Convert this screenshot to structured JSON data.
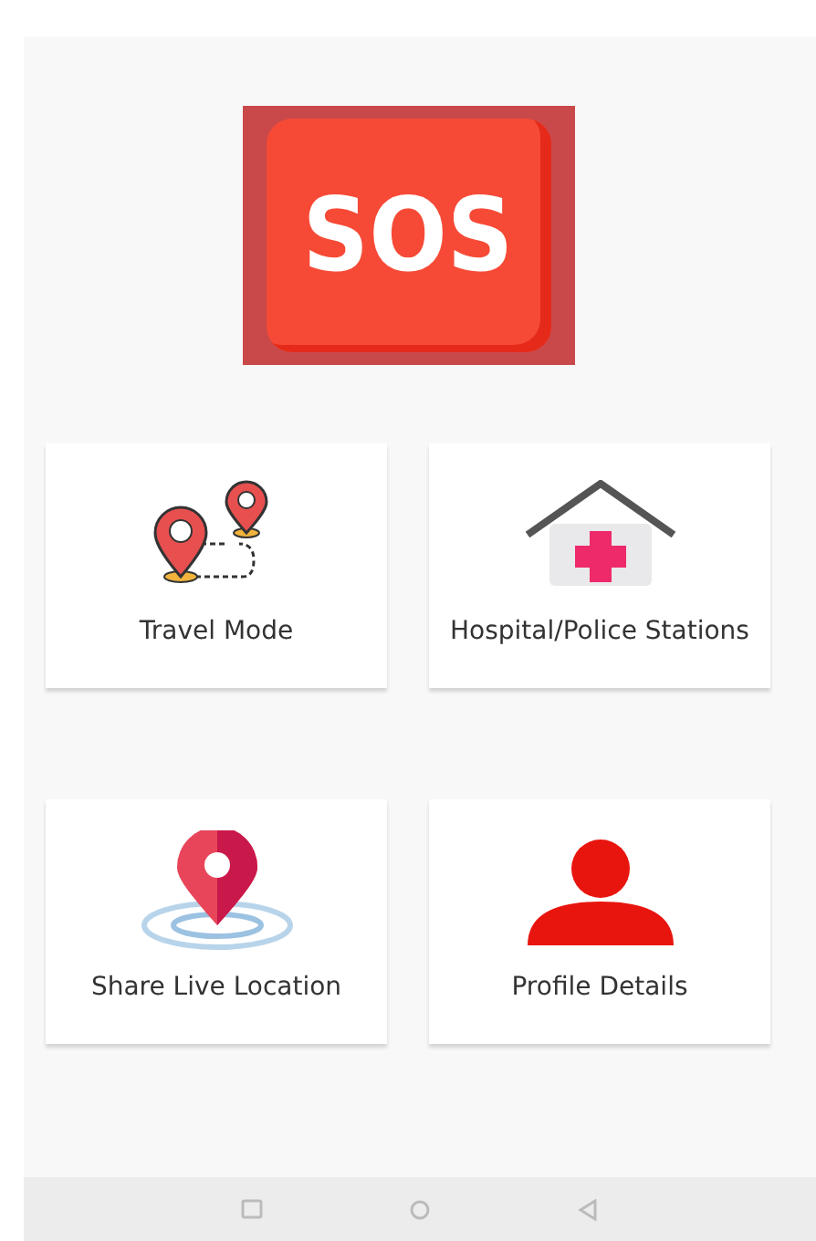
{
  "sos_button": {
    "label": "SOS"
  },
  "cards": [
    {
      "kind": "travel",
      "label": "Travel Mode"
    },
    {
      "kind": "hospital",
      "label": "Hospital/Police Stations"
    },
    {
      "kind": "location",
      "label": "Share Live Location"
    },
    {
      "kind": "profile",
      "label": "Profile Details"
    }
  ]
}
